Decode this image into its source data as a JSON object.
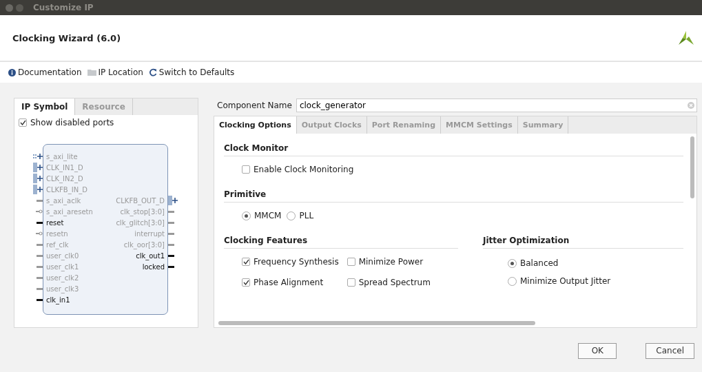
{
  "window": {
    "title": "Customize IP"
  },
  "header": {
    "title": "Clocking Wizard (6.0)"
  },
  "toolbar": [
    {
      "kind": "info",
      "label": "Documentation"
    },
    {
      "kind": "folder",
      "label": "IP Location"
    },
    {
      "kind": "refresh",
      "label": "Switch to Defaults"
    }
  ],
  "left_tabs": [
    {
      "label": "IP Symbol",
      "selected": true
    },
    {
      "label": "Resource",
      "selected": false
    }
  ],
  "show_disabled_ports": {
    "label": "Show disabled ports",
    "checked": true
  },
  "symbol": {
    "inputs": [
      {
        "name": "s_axi_lite",
        "kind": "interface",
        "enabled": false
      },
      {
        "name": "CLK_IN1_D",
        "kind": "bus",
        "enabled": false
      },
      {
        "name": "CLK_IN2_D",
        "kind": "bus",
        "enabled": false
      },
      {
        "name": "CLKFB_IN_D",
        "kind": "bus",
        "enabled": false
      },
      {
        "name": "s_axi_aclk",
        "kind": "wire",
        "enabled": false
      },
      {
        "name": "s_axi_aresetn",
        "kind": "inverted",
        "enabled": false
      },
      {
        "name": "reset",
        "kind": "wire",
        "enabled": true
      },
      {
        "name": "resetn",
        "kind": "inverted",
        "enabled": false
      },
      {
        "name": "ref_clk",
        "kind": "wire",
        "enabled": false
      },
      {
        "name": "user_clk0",
        "kind": "wire",
        "enabled": false
      },
      {
        "name": "user_clk1",
        "kind": "wire",
        "enabled": false
      },
      {
        "name": "user_clk2",
        "kind": "wire",
        "enabled": false
      },
      {
        "name": "user_clk3",
        "kind": "wire",
        "enabled": false
      },
      {
        "name": "clk_in1",
        "kind": "wire",
        "enabled": true
      }
    ],
    "outputs": [
      {
        "name": "CLKFB_OUT_D",
        "kind": "bus",
        "enabled": false
      },
      {
        "name": "clk_stop[3:0]",
        "kind": "wire",
        "enabled": false
      },
      {
        "name": "clk_glitch[3:0]",
        "kind": "wire",
        "enabled": false
      },
      {
        "name": "interrupt",
        "kind": "wire",
        "enabled": false
      },
      {
        "name": "clk_oor[3:0]",
        "kind": "wire",
        "enabled": false
      },
      {
        "name": "clk_out1",
        "kind": "wire",
        "enabled": true
      },
      {
        "name": "locked",
        "kind": "wire",
        "enabled": true
      }
    ]
  },
  "component_name": {
    "label": "Component Name",
    "value": "clock_generator"
  },
  "tabs": [
    {
      "label": "Clocking Options",
      "selected": true
    },
    {
      "label": "Output Clocks",
      "selected": false
    },
    {
      "label": "Port Renaming",
      "selected": false
    },
    {
      "label": "MMCM Settings",
      "selected": false
    },
    {
      "label": "Summary",
      "selected": false
    }
  ],
  "sections": [
    {
      "title": "Clock Monitor",
      "options": [
        {
          "kind": "checkbox",
          "label": "Enable Clock Monitoring",
          "checked": false
        }
      ]
    },
    {
      "title": "Primitive",
      "options": [
        {
          "kind": "radio",
          "label": "MMCM",
          "selected": true
        },
        {
          "kind": "radio",
          "label": "PLL",
          "selected": false
        }
      ]
    }
  ],
  "clocking_features": {
    "title": "Clocking Features",
    "options": [
      {
        "label": "Frequency Synthesis",
        "checked": true
      },
      {
        "label": "Minimize Power",
        "checked": false
      },
      {
        "label": "Phase Alignment",
        "checked": true
      },
      {
        "label": "Spread Spectrum",
        "checked": false
      }
    ]
  },
  "jitter_optimization": {
    "title": "Jitter Optimization",
    "options": [
      {
        "label": "Balanced",
        "selected": true
      },
      {
        "label": "Minimize Output Jitter",
        "selected": false
      }
    ]
  },
  "buttons": [
    "OK",
    "Cancel"
  ]
}
